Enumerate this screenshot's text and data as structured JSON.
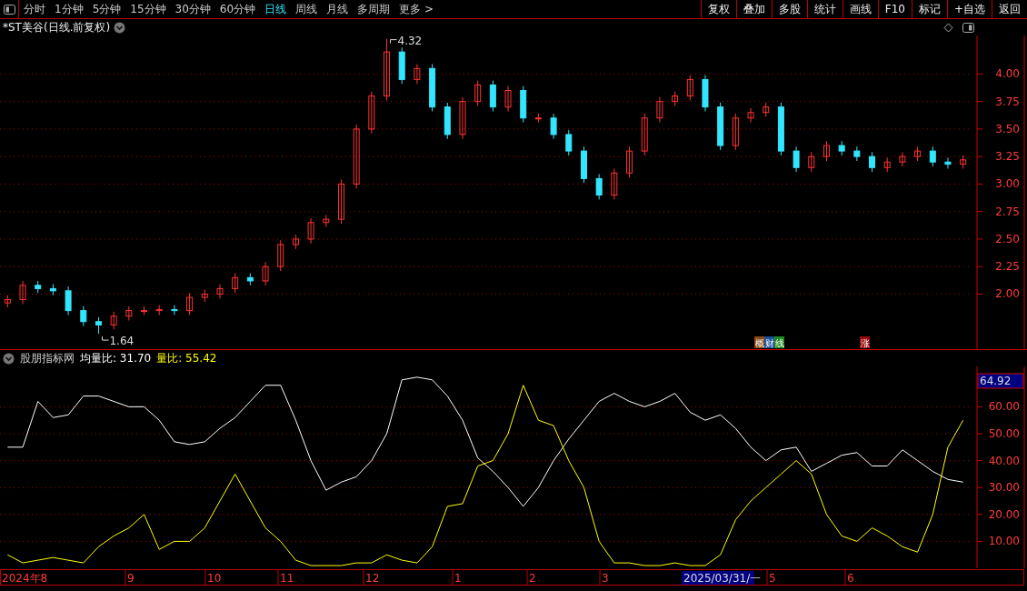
{
  "toolbar": {
    "periods": [
      {
        "label": "分时",
        "selected": false
      },
      {
        "label": "1分钟",
        "selected": false
      },
      {
        "label": "5分钟",
        "selected": false
      },
      {
        "label": "15分钟",
        "selected": false
      },
      {
        "label": "30分钟",
        "selected": false
      },
      {
        "label": "60分钟",
        "selected": false
      },
      {
        "label": "日线",
        "selected": true
      },
      {
        "label": "周线",
        "selected": false
      },
      {
        "label": "月线",
        "selected": false
      },
      {
        "label": "多周期",
        "selected": false
      },
      {
        "label": "更多 >",
        "selected": false
      }
    ],
    "buttons": [
      "复权",
      "叠加",
      "多股",
      "统计",
      "画线",
      "F10",
      "标记",
      "+自选",
      "返回"
    ]
  },
  "price_panel": {
    "title": "*ST美谷(日线.前复权)",
    "chart_data": {
      "type": "candlestick",
      "grid": true,
      "ylim": [
        1.5,
        4.35
      ],
      "yticks": [
        {
          "value": 2.0,
          "label": "2.00"
        },
        {
          "value": 2.25,
          "label": "2.25"
        },
        {
          "value": 2.5,
          "label": "2.50"
        },
        {
          "value": 2.75,
          "label": "2.75"
        },
        {
          "value": 3.0,
          "label": "3.00"
        },
        {
          "value": 3.25,
          "label": "3.25"
        },
        {
          "value": 3.5,
          "label": "3.50"
        },
        {
          "value": 3.75,
          "label": "3.75"
        },
        {
          "value": 4.0,
          "label": "4.00"
        }
      ],
      "ohlc": [
        [
          1.92,
          1.99,
          1.88,
          1.95
        ],
        [
          1.95,
          2.12,
          1.91,
          2.08
        ],
        [
          2.08,
          2.12,
          2.01,
          2.05
        ],
        [
          2.05,
          2.09,
          1.99,
          2.03
        ],
        [
          2.03,
          2.07,
          1.81,
          1.85
        ],
        [
          1.85,
          1.89,
          1.71,
          1.75
        ],
        [
          1.75,
          1.79,
          1.64,
          1.72
        ],
        [
          1.72,
          1.84,
          1.68,
          1.8
        ],
        [
          1.8,
          1.89,
          1.76,
          1.85
        ],
        [
          1.85,
          1.89,
          1.81,
          1.85
        ],
        [
          1.85,
          1.9,
          1.81,
          1.86
        ],
        [
          1.86,
          1.9,
          1.81,
          1.85
        ],
        [
          1.85,
          2.01,
          1.81,
          1.97
        ],
        [
          1.97,
          2.04,
          1.93,
          2.0
        ],
        [
          2.0,
          2.09,
          1.96,
          2.05
        ],
        [
          2.05,
          2.19,
          2.01,
          2.15
        ],
        [
          2.15,
          2.19,
          2.08,
          2.12
        ],
        [
          2.12,
          2.29,
          2.08,
          2.25
        ],
        [
          2.25,
          2.49,
          2.21,
          2.45
        ],
        [
          2.45,
          2.54,
          2.41,
          2.5
        ],
        [
          2.5,
          2.69,
          2.46,
          2.65
        ],
        [
          2.65,
          2.72,
          2.61,
          2.68
        ],
        [
          2.68,
          3.04,
          2.64,
          3.0
        ],
        [
          3.0,
          3.54,
          2.96,
          3.5
        ],
        [
          3.5,
          3.84,
          3.46,
          3.8
        ],
        [
          3.8,
          4.32,
          3.76,
          4.2
        ],
        [
          4.2,
          4.24,
          3.91,
          3.95
        ],
        [
          3.95,
          4.09,
          3.91,
          4.05
        ],
        [
          4.05,
          4.09,
          3.66,
          3.7
        ],
        [
          3.7,
          3.74,
          3.41,
          3.45
        ],
        [
          3.45,
          3.79,
          3.41,
          3.75
        ],
        [
          3.75,
          3.94,
          3.71,
          3.9
        ],
        [
          3.9,
          3.94,
          3.66,
          3.7
        ],
        [
          3.7,
          3.89,
          3.66,
          3.85
        ],
        [
          3.85,
          3.89,
          3.56,
          3.6
        ],
        [
          3.6,
          3.64,
          3.56,
          3.6
        ],
        [
          3.6,
          3.64,
          3.41,
          3.45
        ],
        [
          3.45,
          3.49,
          3.26,
          3.3
        ],
        [
          3.3,
          3.34,
          3.01,
          3.05
        ],
        [
          3.05,
          3.09,
          2.86,
          2.9
        ],
        [
          2.9,
          3.14,
          2.86,
          3.1
        ],
        [
          3.1,
          3.34,
          3.06,
          3.3
        ],
        [
          3.3,
          3.64,
          3.26,
          3.6
        ],
        [
          3.6,
          3.79,
          3.56,
          3.75
        ],
        [
          3.75,
          3.84,
          3.71,
          3.8
        ],
        [
          3.8,
          3.99,
          3.76,
          3.95
        ],
        [
          3.95,
          3.99,
          3.66,
          3.7
        ],
        [
          3.7,
          3.74,
          3.31,
          3.35
        ],
        [
          3.35,
          3.64,
          3.31,
          3.6
        ],
        [
          3.6,
          3.69,
          3.56,
          3.65
        ],
        [
          3.65,
          3.74,
          3.61,
          3.7
        ],
        [
          3.7,
          3.74,
          3.26,
          3.3
        ],
        [
          3.3,
          3.34,
          3.11,
          3.15
        ],
        [
          3.15,
          3.29,
          3.11,
          3.25
        ],
        [
          3.25,
          3.39,
          3.21,
          3.35
        ],
        [
          3.35,
          3.39,
          3.26,
          3.3
        ],
        [
          3.3,
          3.34,
          3.21,
          3.25
        ],
        [
          3.25,
          3.29,
          3.11,
          3.15
        ],
        [
          3.15,
          3.24,
          3.11,
          3.2
        ],
        [
          3.2,
          3.29,
          3.16,
          3.25
        ],
        [
          3.25,
          3.34,
          3.21,
          3.3
        ],
        [
          3.3,
          3.34,
          3.16,
          3.2
        ],
        [
          3.2,
          3.24,
          3.14,
          3.18
        ],
        [
          3.18,
          3.26,
          3.14,
          3.22
        ]
      ],
      "annotations": [
        "4.32",
        "1.64"
      ]
    },
    "event_tags": [
      {
        "tags": [
          {
            "text": "概",
            "color": "#8b4a14"
          },
          {
            "text": "财",
            "color": "#1a4f9a"
          },
          {
            "text": "线",
            "color": "#1f8a1f"
          }
        ]
      },
      {
        "tags": [
          {
            "text": "涨",
            "color": "#9a0c0c"
          }
        ]
      }
    ]
  },
  "indicator_panel": {
    "name": "股朋指标网",
    "separator": ": ",
    "readouts": [
      "31.70",
      "55.42"
    ],
    "chart_data": {
      "type": "line",
      "grid": true,
      "ylim": [
        0,
        75
      ],
      "yticks": [
        {
          "value": 10,
          "label": "10.00"
        },
        {
          "value": 20,
          "label": "20.00"
        },
        {
          "value": 30,
          "label": "30.00"
        },
        {
          "value": 40,
          "label": "40.00"
        },
        {
          "value": 50,
          "label": "50.00"
        },
        {
          "value": 60,
          "label": "60.00"
        }
      ],
      "series": [
        {
          "name": "均量比",
          "color": "#ffffff",
          "values": [
            45,
            45,
            62,
            56,
            57,
            64,
            64,
            62,
            60,
            60,
            55,
            47,
            46,
            47,
            52,
            56,
            62,
            68,
            68,
            55,
            40,
            29,
            32,
            34,
            40,
            50,
            70,
            71,
            70,
            64,
            55,
            41,
            36,
            30,
            23,
            30,
            40,
            48,
            55,
            62,
            65,
            62,
            60,
            62,
            65,
            58,
            55,
            57,
            52,
            45,
            40,
            44,
            45,
            36,
            39,
            42,
            43,
            38,
            38,
            44,
            40,
            36,
            33,
            32
          ]
        },
        {
          "name": "量比",
          "color": "#ffff00",
          "values": [
            5,
            2,
            3,
            4,
            3,
            2,
            8,
            12,
            15,
            20,
            7,
            10,
            10,
            15,
            25,
            35,
            25,
            15,
            10,
            3,
            1,
            1,
            1,
            2,
            2,
            5,
            3,
            2,
            8,
            23,
            24,
            38,
            40,
            50,
            68,
            55,
            53,
            40,
            30,
            10,
            2,
            2,
            1,
            1,
            2,
            1,
            1,
            5,
            18,
            25,
            30,
            35,
            40,
            35,
            20,
            12,
            10,
            15,
            12,
            8,
            6,
            20,
            45,
            55
          ]
        }
      ],
      "annotations": [
        "64.92"
      ]
    },
    "date_axis": {
      "labels": [
        "2024年8",
        "9",
        "10",
        "11",
        "12",
        "1",
        "2",
        "3",
        "5",
        "6"
      ],
      "cursor_date": "2025/03/31/一"
    }
  }
}
